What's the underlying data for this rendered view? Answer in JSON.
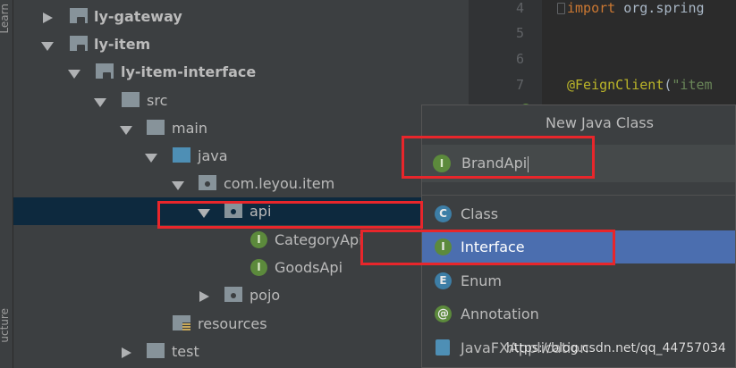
{
  "side_tabs": {
    "top": "Learn",
    "bottom": "ucture"
  },
  "tree": {
    "items": [
      {
        "label": "ly-gateway",
        "bold": true
      },
      {
        "label": "ly-item",
        "bold": true
      },
      {
        "label": "ly-item-interface",
        "bold": true
      },
      {
        "label": "src"
      },
      {
        "label": "main"
      },
      {
        "label": "java"
      },
      {
        "label": "com.leyou.item"
      },
      {
        "label": "api"
      },
      {
        "label": "CategoryApi"
      },
      {
        "label": "GoodsApi"
      },
      {
        "label": "pojo"
      },
      {
        "label": "resources"
      },
      {
        "label": "test"
      }
    ],
    "interface_badge": "I"
  },
  "editor": {
    "line_numbers": [
      "4",
      "5",
      "6",
      "7"
    ],
    "import_keyword": "import",
    "import_rest": " org.spring",
    "annotation": "@FeignClient",
    "annotation_paren": "(",
    "annotation_string": "\"item"
  },
  "dialog": {
    "title": "New Java Class",
    "name_badge": "I",
    "name_value": "BrandApi",
    "kinds": [
      {
        "badge": "C",
        "label": "Class"
      },
      {
        "badge": "I",
        "label": "Interface"
      },
      {
        "badge": "E",
        "label": "Enum"
      },
      {
        "badge": "@",
        "label": "Annotation"
      },
      {
        "badge": "",
        "label": "JavaFXApplication"
      }
    ],
    "selected_kind": "Interface"
  },
  "watermark": "https://blog.csdn.net/qq_44757034",
  "colors": {
    "highlight_box": "#e8262b",
    "selection": "#4b6eaf",
    "tree_selection": "#0d293e"
  }
}
